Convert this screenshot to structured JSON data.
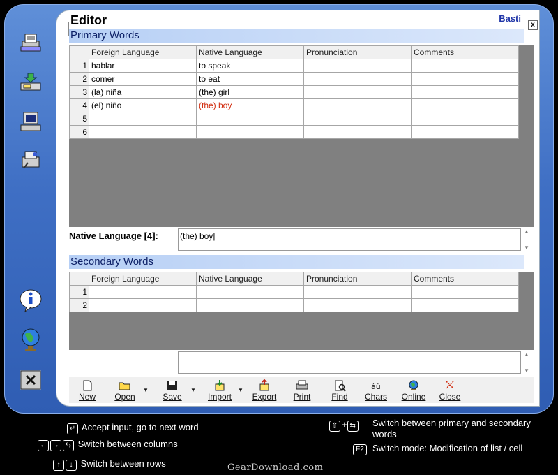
{
  "editor": {
    "title": "Editor",
    "user": "Basti",
    "close_glyph": "x"
  },
  "sidebar": {
    "icons": [
      {
        "name": "print-list-icon"
      },
      {
        "name": "import-icon"
      },
      {
        "name": "computer-icon"
      },
      {
        "name": "tools-icon"
      },
      {
        "name": "info-icon"
      },
      {
        "name": "globe-icon"
      },
      {
        "name": "exit-icon"
      }
    ]
  },
  "primary": {
    "title": "Primary Words",
    "columns": [
      "Foreign Language",
      "Native Language",
      "Pronunciation",
      "Comments"
    ],
    "rows": [
      {
        "num": "1",
        "foreign": "hablar",
        "native": "to speak",
        "pron": "",
        "comments": ""
      },
      {
        "num": "2",
        "foreign": "comer",
        "native": "to eat",
        "pron": "",
        "comments": ""
      },
      {
        "num": "3",
        "foreign": "(la) niña",
        "native": "(the) girl",
        "pron": "",
        "comments": ""
      },
      {
        "num": "4",
        "foreign": "(el) niño",
        "native": "(the) boy",
        "pron": "",
        "comments": ""
      },
      {
        "num": "5",
        "foreign": "",
        "native": "",
        "pron": "",
        "comments": ""
      },
      {
        "num": "6",
        "foreign": "",
        "native": "",
        "pron": "",
        "comments": ""
      }
    ]
  },
  "edit": {
    "label": "Native Language [4]:",
    "value": "(the) boy|"
  },
  "secondary": {
    "title": "Secondary Words",
    "columns": [
      "Foreign Language",
      "Native Language",
      "Pronunciation",
      "Comments"
    ],
    "rows": [
      {
        "num": "1",
        "foreign": "",
        "native": "",
        "pron": "",
        "comments": ""
      },
      {
        "num": "2",
        "foreign": "",
        "native": "",
        "pron": "",
        "comments": ""
      }
    ]
  },
  "edit2": {
    "value": ""
  },
  "toolbar": {
    "new": "New",
    "open": "Open",
    "save": "Save",
    "import": "Import",
    "export": "Export",
    "print": "Print",
    "find": "Find",
    "chars": "Chars",
    "online": "Online",
    "close": "Close"
  },
  "help": {
    "accept": "Accept input, go to next word",
    "columns": "Switch between columns",
    "rows": "Switch between rows",
    "primary_secondary": "Switch between primary and secondary words",
    "mode": "Switch mode: Modification of list / cell",
    "f2": "F2"
  },
  "brand": "GearDownload.com",
  "colors": {
    "highlight": "#d12b0e",
    "frame": "#3f6fc4",
    "section": "#b6cff5"
  }
}
